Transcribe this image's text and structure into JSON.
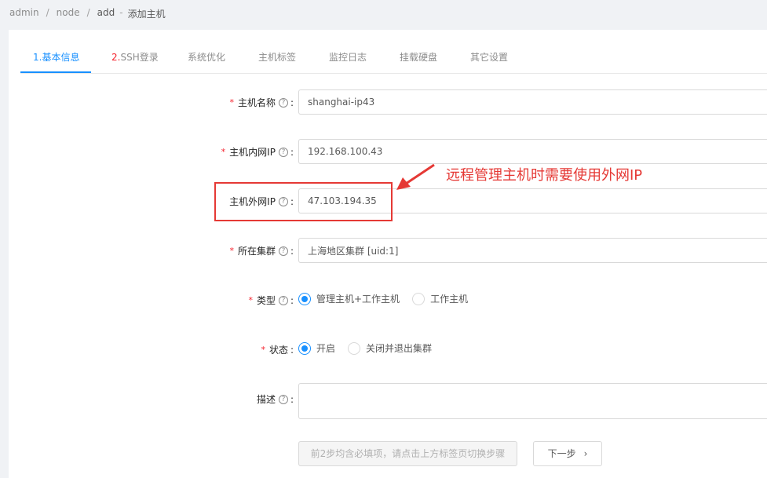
{
  "breadcrumb": {
    "items": [
      "admin",
      "node",
      "add"
    ],
    "sep": "/",
    "current": "添加主机",
    "dash": "-"
  },
  "tabs": [
    {
      "num": "1.",
      "label": "基本信息"
    },
    {
      "num": "2.",
      "label": "SSH登录"
    },
    {
      "num": "",
      "label": "系统优化"
    },
    {
      "num": "",
      "label": "主机标签"
    },
    {
      "num": "",
      "label": "监控日志"
    },
    {
      "num": "",
      "label": "挂载硬盘"
    },
    {
      "num": "",
      "label": "其它设置"
    }
  ],
  "form": {
    "required_mark": "*",
    "help_icon": "?",
    "colon": ":",
    "hostname": {
      "label": "主机名称",
      "value": "shanghai-ip43"
    },
    "internal_ip": {
      "label": "主机内网IP",
      "value": "192.168.100.43"
    },
    "external_ip": {
      "label": "主机外网IP",
      "value": "47.103.194.35"
    },
    "cluster": {
      "label": "所在集群",
      "value": "上海地区集群 [uid:1]"
    },
    "type": {
      "label": "类型",
      "options": [
        "管理主机+工作主机",
        "工作主机"
      ],
      "selected": "管理主机+工作主机"
    },
    "status": {
      "label": "状态",
      "options": [
        "开启",
        "关闭并退出集群"
      ],
      "selected": "开启"
    },
    "description": {
      "label": "描述",
      "value": ""
    }
  },
  "annotation": {
    "text": "远程管理主机时需要使用外网IP",
    "color": "#e53935"
  },
  "buttons": {
    "hint": "前2步均含必填项，请点击上方标签页切换步骤",
    "next": "下一步",
    "next_icon": "chevron-right-icon"
  },
  "colors": {
    "accent": "#1890ff",
    "required": "#f5222d"
  }
}
